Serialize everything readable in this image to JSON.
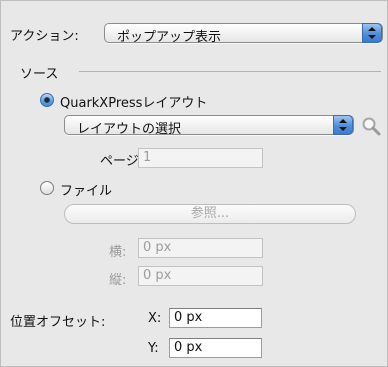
{
  "action": {
    "label": "アクション:",
    "popup_value": "ポップアップ表示"
  },
  "source": {
    "heading": "ソース",
    "layout_radio_label": "QuarkXPressレイアウト",
    "layout_radio_selected": true,
    "layout_popup_value": "レイアウトの選択",
    "page_label": "ページ:",
    "page_value": "1",
    "file_radio_label": "ファイル",
    "file_radio_selected": false,
    "browse_button_label": "参照...",
    "width_label": "横:",
    "width_value": "0 px",
    "height_label": "縦:",
    "height_value": "0 px"
  },
  "offset": {
    "label": "位置オフセット:",
    "x_label": "X:",
    "x_value": "0 px",
    "y_label": "Y:",
    "y_value": "0 px"
  },
  "colors": {
    "accent": "#4d8fd9",
    "panel_bg": "#e8e8e8"
  }
}
